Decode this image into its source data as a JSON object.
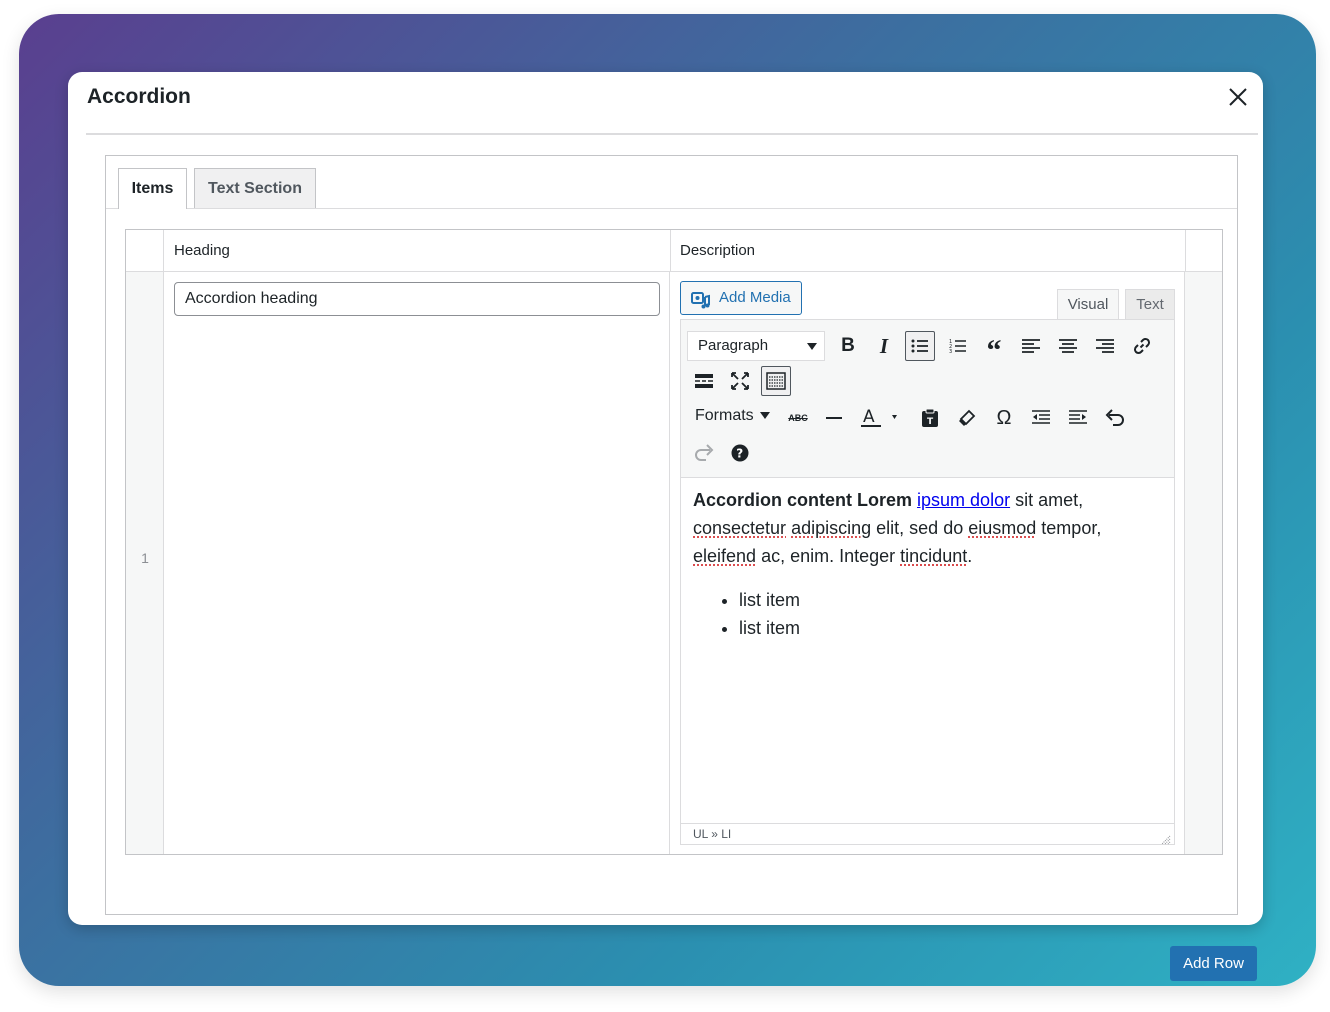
{
  "modal": {
    "title": "Accordion",
    "close_icon": "close-icon"
  },
  "tabs": [
    {
      "label": "Items",
      "active": true
    },
    {
      "label": "Text Section",
      "active": false
    }
  ],
  "table": {
    "columns": [
      "Heading",
      "Description"
    ],
    "rows": [
      {
        "number": "1",
        "heading_value": "Accordion heading"
      }
    ]
  },
  "editor": {
    "add_media_label": "Add Media",
    "mode_tabs": [
      "Visual",
      "Text"
    ],
    "block_format": "Paragraph",
    "formats_label": "Formats",
    "content": {
      "bold_text": "Accordion content Lorem",
      "link_text": "ipsum dolor",
      "text_after_link": "sit amet,",
      "line2_a": "consectetur",
      "line2_b": "adipiscing",
      "line2_c": "elit, sed do",
      "line2_d": "eiusmod",
      "line2_e": "tempor,",
      "line3_a": "eleifend",
      "line3_b": "ac, enim. Integer",
      "line3_c": "tincidunt",
      "line3_d": ".",
      "list_items": [
        "list item",
        "list item"
      ]
    },
    "status_path": "UL » LI"
  },
  "add_row_label": "Add Row",
  "colors": {
    "primary": "#2271b1",
    "border": "#c3c4c7",
    "background_gradient_start": "#5a3f8f",
    "background_gradient_end": "#2fb1c4"
  }
}
